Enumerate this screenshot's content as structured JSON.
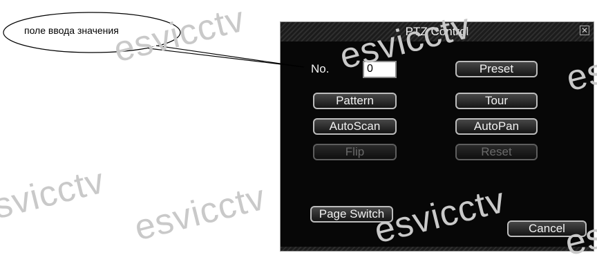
{
  "annotation": {
    "text": "поле ввода значения"
  },
  "watermark": "esvicctv",
  "dialog": {
    "title": "PTZ Control",
    "close_glyph": "✕",
    "no_label": "No.",
    "no_value": "0",
    "buttons": {
      "preset": "Preset",
      "pattern": "Pattern",
      "tour": "Tour",
      "autoscan": "AutoScan",
      "autopan": "AutoPan",
      "flip": "Flip",
      "reset": "Reset",
      "page_switch": "Page Switch",
      "cancel": "Cancel"
    }
  }
}
